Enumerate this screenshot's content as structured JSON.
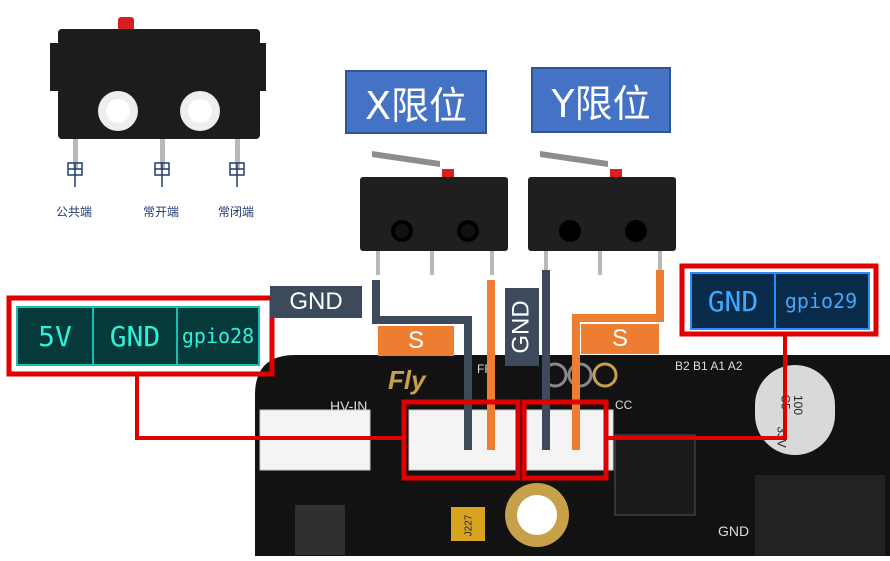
{
  "diagram": {
    "switch_x_title": "X限位",
    "switch_y_title": "Y限位",
    "pin_labels": [
      "公共端",
      "常开端",
      "常闭端"
    ],
    "wire_gnd_label": "GND",
    "wire_s_label": "S",
    "left_header": [
      "5V",
      "GND",
      "gpio28"
    ],
    "right_header": [
      "GND",
      "gpio29"
    ],
    "board_text": {
      "brand": "Fly",
      "hv_in": "HV-IN",
      "pins_top": "B2 B1 A1 A2",
      "vcc": "CC",
      "cap_line1": "C5",
      "cap_line2": "100",
      "cap_line3": "33V",
      "chip": "J227",
      "gnd_bottom": "GND",
      "fr": "FR"
    },
    "colors": {
      "title_bg": "#4472C4",
      "highlight": "#E00000",
      "gnd_wire": "#3d4a5c",
      "s_wire": "#ED7D31"
    }
  }
}
